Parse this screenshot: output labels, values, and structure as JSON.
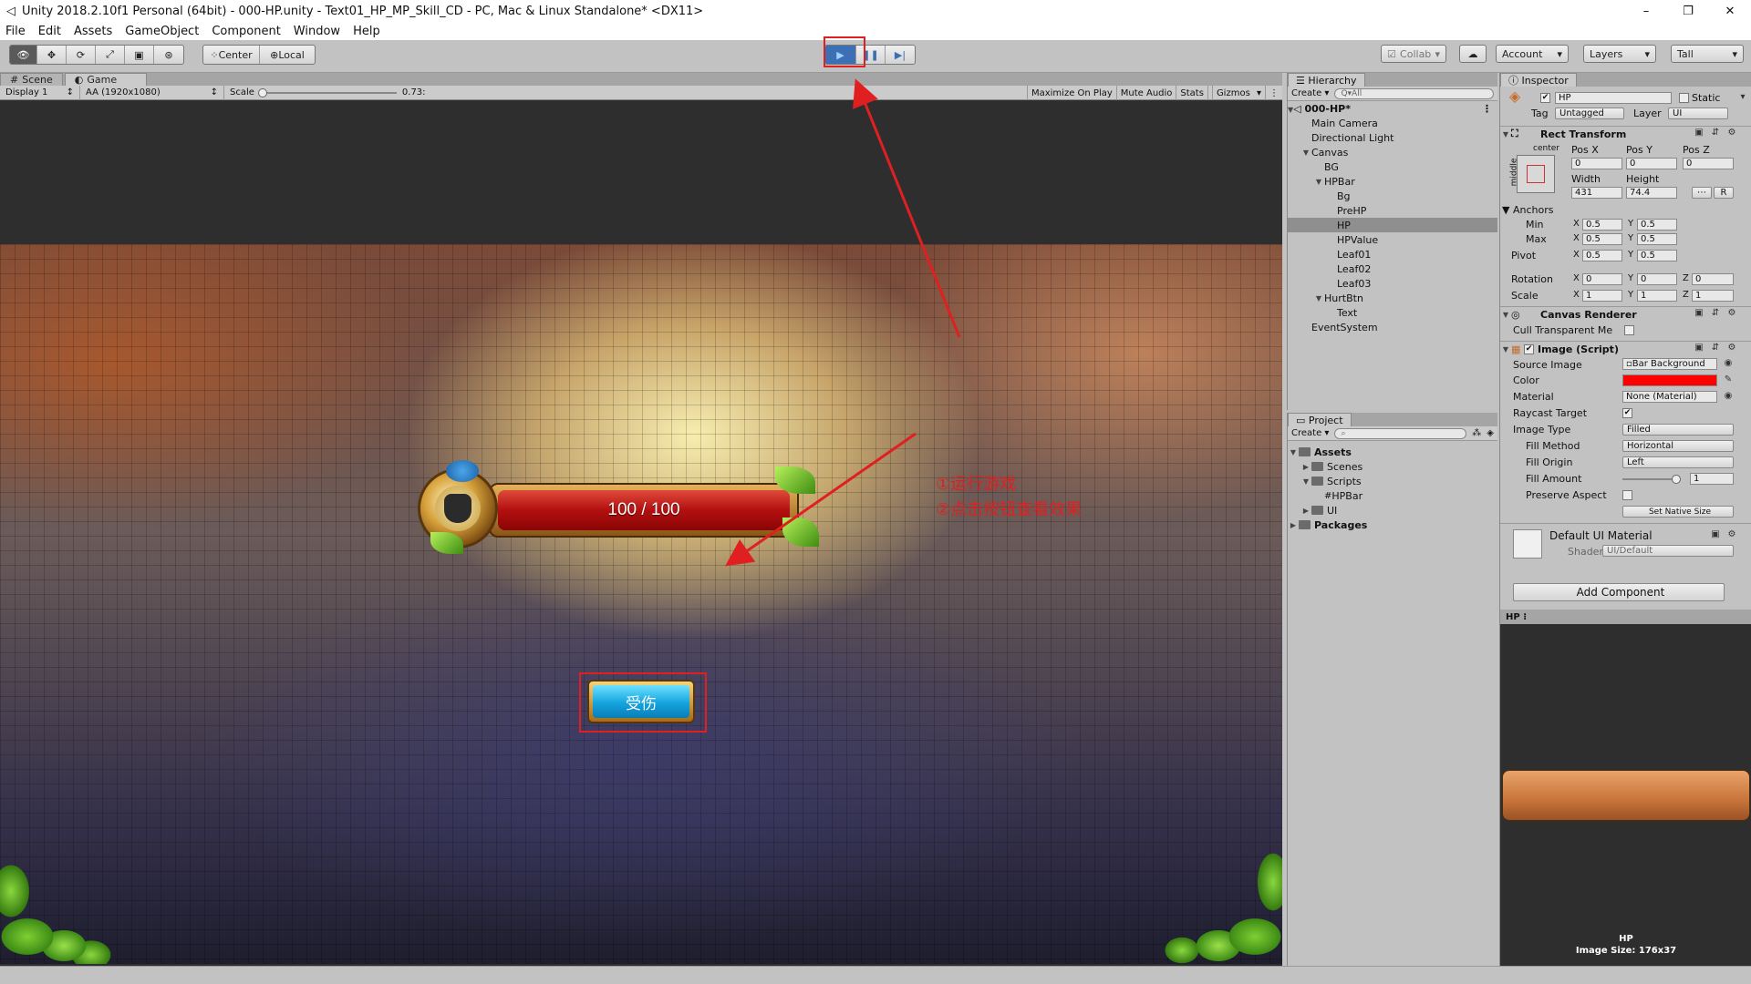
{
  "window": {
    "title": "Unity 2018.2.10f1 Personal (64bit) - 000-HP.unity - Text01_HP_MP_Skill_CD - PC, Mac & Linux Standalone* <DX11>",
    "minimize": "–",
    "maximize": "❐",
    "close": "✕"
  },
  "menu": [
    "File",
    "Edit",
    "Assets",
    "GameObject",
    "Component",
    "Window",
    "Help"
  ],
  "toolbar": {
    "pivot": "Center",
    "space": "Local",
    "collab": "Collab",
    "account": "Account",
    "layers": "Layers",
    "layout": "Tall",
    "play_state": "playing",
    "play_accent": "#3d6fb5"
  },
  "game_view": {
    "tabs": [
      "Scene",
      "Game"
    ],
    "active_tab": "Game",
    "display": "Display 1",
    "resolution": "AA (1920x1080)",
    "scale_label": "Scale",
    "scale_value": "0.73:",
    "options": [
      "Maximize On Play",
      "Mute Audio",
      "Stats",
      "Gizmos"
    ]
  },
  "game": {
    "hp_text": "100 / 100",
    "hp_fill_fraction": 1.0,
    "hurt_button": "受伤"
  },
  "annotation": {
    "line1": "①运行游戏",
    "line2": "②点击按钮查看效果",
    "color": "#e02020"
  },
  "hierarchy": {
    "title": "Hierarchy",
    "create": "Create",
    "search_placeholder": "Q▾All",
    "scene": "000-HP*",
    "items": [
      {
        "label": "Main Camera",
        "depth": 1
      },
      {
        "label": "Directional Light",
        "depth": 1
      },
      {
        "label": "Canvas",
        "depth": 1,
        "expanded": true
      },
      {
        "label": "BG",
        "depth": 2
      },
      {
        "label": "HPBar",
        "depth": 2,
        "expanded": true
      },
      {
        "label": "Bg",
        "depth": 3
      },
      {
        "label": "PreHP",
        "depth": 3
      },
      {
        "label": "HP",
        "depth": 3,
        "selected": true
      },
      {
        "label": "HPValue",
        "depth": 3
      },
      {
        "label": "Leaf01",
        "depth": 3
      },
      {
        "label": "Leaf02",
        "depth": 3
      },
      {
        "label": "Leaf03",
        "depth": 3
      },
      {
        "label": "HurtBtn",
        "depth": 2,
        "expanded": true
      },
      {
        "label": "Text",
        "depth": 3
      },
      {
        "label": "EventSystem",
        "depth": 1
      }
    ]
  },
  "project": {
    "title": "Project",
    "create": "Create",
    "items": [
      {
        "label": "Assets",
        "depth": 0,
        "expanded": true,
        "bold": true
      },
      {
        "label": "Scenes",
        "depth": 1
      },
      {
        "label": "Scripts",
        "depth": 1,
        "expanded": true
      },
      {
        "label": "HPBar",
        "depth": 2,
        "script": true
      },
      {
        "label": "UI",
        "depth": 1
      },
      {
        "label": "Packages",
        "depth": 0,
        "bold": true
      }
    ]
  },
  "inspector": {
    "title": "Inspector",
    "object_name": "HP",
    "static_label": "Static",
    "tag_label": "Tag",
    "tag_value": "Untagged",
    "layer_label": "Layer",
    "layer_value": "UI",
    "rect_transform": {
      "title": "Rect Transform",
      "anchor_h": "center",
      "anchor_v": "middle",
      "pos_x_label": "Pos X",
      "pos_y_label": "Pos Y",
      "pos_z_label": "Pos Z",
      "pos_x": "0",
      "pos_y": "0",
      "pos_z": "0",
      "width_label": "Width",
      "height_label": "Height",
      "width": "431",
      "height": "74.4",
      "anchors_label": "Anchors",
      "min_label": "Min",
      "min_x": "0.5",
      "min_y": "0.5",
      "max_label": "Max",
      "max_x": "0.5",
      "max_y": "0.5",
      "pivot_label": "Pivot",
      "pivot_x": "0.5",
      "pivot_y": "0.5",
      "rotation_label": "Rotation",
      "rot_x": "0",
      "rot_y": "0",
      "rot_z": "0",
      "scale_label": "Scale",
      "scale_x": "1",
      "scale_y": "1",
      "scale_z": "1",
      "x": "X",
      "y": "Y",
      "z": "Z",
      "r": "R"
    },
    "canvas_renderer": {
      "title": "Canvas Renderer",
      "cull_label": "Cull Transparent Me"
    },
    "image": {
      "title": "Image (Script)",
      "source_label": "Source Image",
      "source_value": "Bar Background",
      "color_label": "Color",
      "color_value": "#ff0000",
      "material_label": "Material",
      "material_value": "None (Material)",
      "raycast_label": "Raycast Target",
      "image_type_label": "Image Type",
      "image_type_value": "Filled",
      "fill_method_label": "Fill Method",
      "fill_method_value": "Horizontal",
      "fill_origin_label": "Fill Origin",
      "fill_origin_value": "Left",
      "fill_amount_label": "Fill Amount",
      "fill_amount_value": "1",
      "preserve_label": "Preserve Aspect",
      "native_size": "Set Native Size"
    },
    "material": {
      "name": "Default UI Material",
      "shader_label": "Shader",
      "shader_value": "UI/Default"
    },
    "add_component": "Add Component",
    "preview_tab": "HP",
    "preview_name": "HP",
    "preview_size": "Image Size: 176x37"
  }
}
